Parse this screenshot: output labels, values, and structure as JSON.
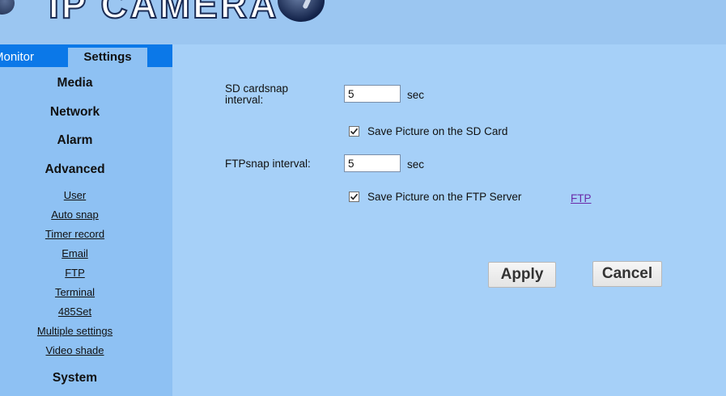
{
  "header": {
    "brand": "IP CAMERA"
  },
  "tabs": [
    {
      "label": "Monitor"
    },
    {
      "label": "Settings"
    }
  ],
  "sidebar": {
    "sections": [
      "Media",
      "Network",
      "Alarm",
      "Advanced",
      "System"
    ],
    "advanced_items": [
      "User",
      "Auto snap",
      "Timer record",
      "Email",
      "FTP",
      "Terminal",
      "485Set",
      "Multiple settings",
      "Video shade"
    ]
  },
  "form": {
    "sd_label": "SD cardsnap interval:",
    "sd_value": "5",
    "sd_unit": "sec",
    "sd_save_label": "Save Picture on the SD Card",
    "sd_save_checked": true,
    "ftp_label": "FTPsnap interval:",
    "ftp_value": "5",
    "ftp_unit": "sec",
    "ftp_save_label": "Save Picture on the FTP Server",
    "ftp_save_checked": true,
    "ftp_link": "FTP"
  },
  "buttons": {
    "apply": "Apply",
    "cancel": "Cancel"
  },
  "colors": {
    "header_bg": "#9bc6f1",
    "tabbar_bg": "#0b78e8",
    "sidebar_bg": "#8ec1f3",
    "content_bg": "#a6d0f8",
    "link_visited": "#6a2aa8"
  },
  "icons": [
    "globe-icon",
    "checkmark-icon"
  ]
}
